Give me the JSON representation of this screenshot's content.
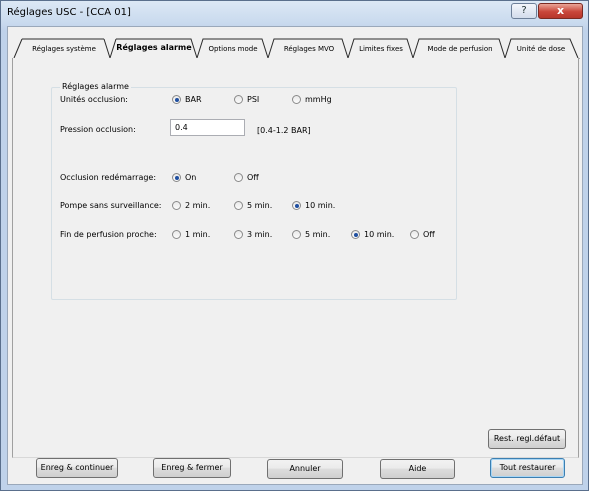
{
  "window": {
    "title": "Réglages USC - [CCA 01]",
    "help_glyph": "?",
    "close_glyph": "x"
  },
  "tabs": [
    {
      "label": "Réglages système",
      "active": false
    },
    {
      "label": "Réglages alarme",
      "active": true
    },
    {
      "label": "Options mode",
      "active": false
    },
    {
      "label": "Réglages MVO",
      "active": false
    },
    {
      "label": "Limites fixes",
      "active": false
    },
    {
      "label": "Mode de perfusion",
      "active": false
    },
    {
      "label": "Unité de dose",
      "active": false
    }
  ],
  "alarm": {
    "group_title": "Réglages alarme",
    "occlusion_units": {
      "label": "Unités occlusion:",
      "options": [
        "BAR",
        "PSI",
        "mmHg"
      ],
      "selected": "BAR"
    },
    "occlusion_pressure": {
      "label": "Pression occlusion:",
      "value": "0.4",
      "range": "[0.4-1.2 BAR]"
    },
    "occlusion_restart": {
      "label": "Occlusion redémarrage:",
      "options": [
        "On",
        "Off"
      ],
      "selected": "On"
    },
    "pump_unattended": {
      "label": "Pompe sans surveillance:",
      "options": [
        "2 min.",
        "5 min.",
        "10 min."
      ],
      "selected": "10 min."
    },
    "end_of_infusion": {
      "label": "Fin de perfusion proche:",
      "options": [
        "1 min.",
        "3 min.",
        "5 min.",
        "10 min.",
        "Off"
      ],
      "selected": "10 min."
    }
  },
  "buttons": {
    "restore_default": "Rest. regl.défaut",
    "save_continue": "Enreg & continuer",
    "save_close": "Enreg & fermer",
    "cancel": "Annuler",
    "help": "Aide",
    "restore_all": "Tout restaurer"
  }
}
